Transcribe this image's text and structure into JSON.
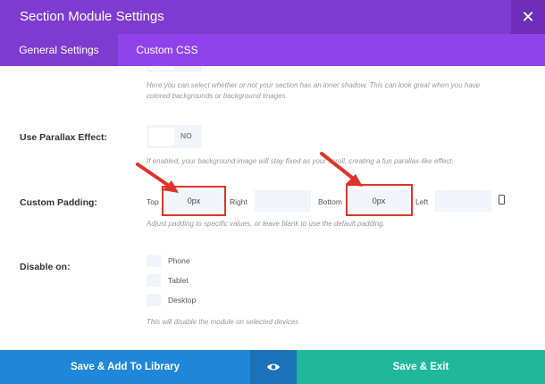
{
  "header": {
    "title": "Section Module Settings",
    "close_icon": "close-icon"
  },
  "tabs": [
    {
      "label": "General Settings",
      "active": true
    },
    {
      "label": "Custom CSS",
      "active": false
    }
  ],
  "inner_shadow": {
    "description": "Here you can select whether or not your section has an inner shadow. This can look great when you have colored backgrounds or background images."
  },
  "parallax": {
    "label": "Use Parallax Effect:",
    "value": "NO",
    "description": "If enabled, your background image will stay fixed as your scroll, creating a fun parallax-like effect."
  },
  "padding": {
    "label": "Custom Padding:",
    "top_label": "Top",
    "top_value": "0px",
    "right_label": "Right",
    "right_value": "",
    "bottom_label": "Bottom",
    "bottom_value": "0px",
    "left_label": "Left",
    "left_value": "",
    "description": "Adjust padding to specific values, or leave blank to use the default padding."
  },
  "disable_on": {
    "label": "Disable on:",
    "options": [
      "Phone",
      "Tablet",
      "Desktop"
    ],
    "description": "This will disable the module on selected devices"
  },
  "footer": {
    "save_library_label": "Save & Add To Library",
    "save_exit_label": "Save & Exit"
  },
  "colors": {
    "header": "#7e3bd0",
    "tabs": "#8f42ec",
    "save_library": "#1f87d9",
    "save_exit": "#1fb89c",
    "highlight": "#e0322e"
  }
}
